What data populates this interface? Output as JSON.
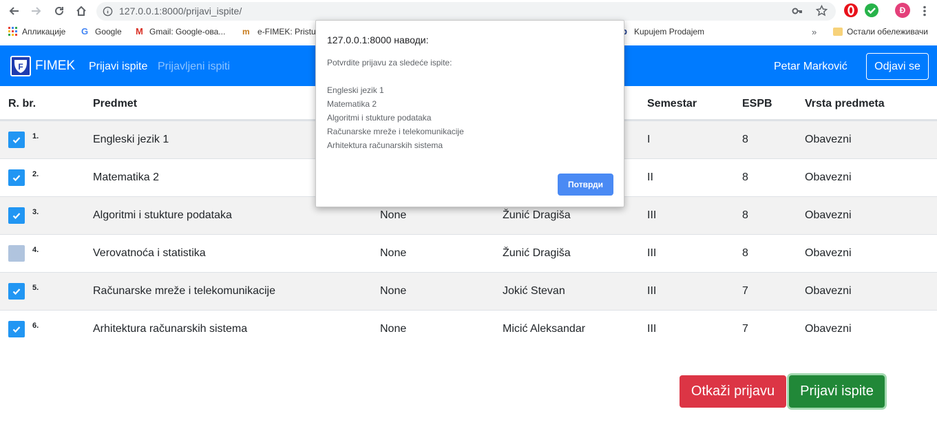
{
  "browser": {
    "url": "127.0.0.1:8000/prijavi_ispite/",
    "profile_initial": "Đ",
    "bookmarks": [
      "Апликације",
      "Google",
      "Gmail: Google-ова...",
      "e-FIMEK: Pristup",
      "Kupujem Prodajem",
      "Остали обележивачи"
    ],
    "overflow": "»"
  },
  "navbar": {
    "brand": "FIMEK",
    "logo_letter": "F",
    "links": [
      "Prijavi ispite",
      "Prijavljeni ispiti"
    ],
    "user": "Petar Marković",
    "logout": "Odjavi se"
  },
  "table": {
    "headers": [
      "R. br.",
      "Predmet",
      "Semestar",
      "ESPB",
      "Vrsta predmeta"
    ],
    "rows": [
      {
        "num": "1.",
        "checked": true,
        "predmet": "Engleski jezik 1",
        "col3": "",
        "profesor": "",
        "semestar": "I",
        "espb": "8",
        "vrsta": "Obavezni"
      },
      {
        "num": "2.",
        "checked": true,
        "predmet": "Matematika 2",
        "col3": "",
        "profesor": "",
        "semestar": "II",
        "espb": "8",
        "vrsta": "Obavezni"
      },
      {
        "num": "3.",
        "checked": true,
        "predmet": "Algoritmi i stukture podataka",
        "col3": "None",
        "profesor": "Žunić Dragiša",
        "semestar": "III",
        "espb": "8",
        "vrsta": "Obavezni"
      },
      {
        "num": "4.",
        "checked": false,
        "predmet": "Verovatnoća i statistika",
        "col3": "None",
        "profesor": "Žunić Dragiša",
        "semestar": "III",
        "espb": "8",
        "vrsta": "Obavezni"
      },
      {
        "num": "5.",
        "checked": true,
        "predmet": "Računarske mreže i telekomunikacije",
        "col3": "None",
        "profesor": "Jokić Stevan",
        "semestar": "III",
        "espb": "7",
        "vrsta": "Obavezni"
      },
      {
        "num": "6.",
        "checked": true,
        "predmet": "Arhitektura računarskih sistema",
        "col3": "None",
        "profesor": "Micić Aleksandar",
        "semestar": "III",
        "espb": "7",
        "vrsta": "Obavezni"
      }
    ]
  },
  "actions": {
    "cancel": "Otkaži prijavu",
    "submit": "Prijavi ispite"
  },
  "dialog": {
    "title": "127.0.0.1:8000 наводи:",
    "message": "Potvrdite prijavu za sledeće ispite:",
    "items": [
      "Engleski jezik 1",
      "Matematika 2",
      "Algoritmi i stukture podataka",
      "Računarske mreže i telekomunikacije",
      "Arhitektura računarskih sistema"
    ],
    "confirm": "Потврди"
  },
  "colors": {
    "primary": "#007bff",
    "danger": "#dc3545",
    "success": "#218838",
    "checkbox": "#2196f3",
    "dialog_button": "#4a8af4"
  }
}
